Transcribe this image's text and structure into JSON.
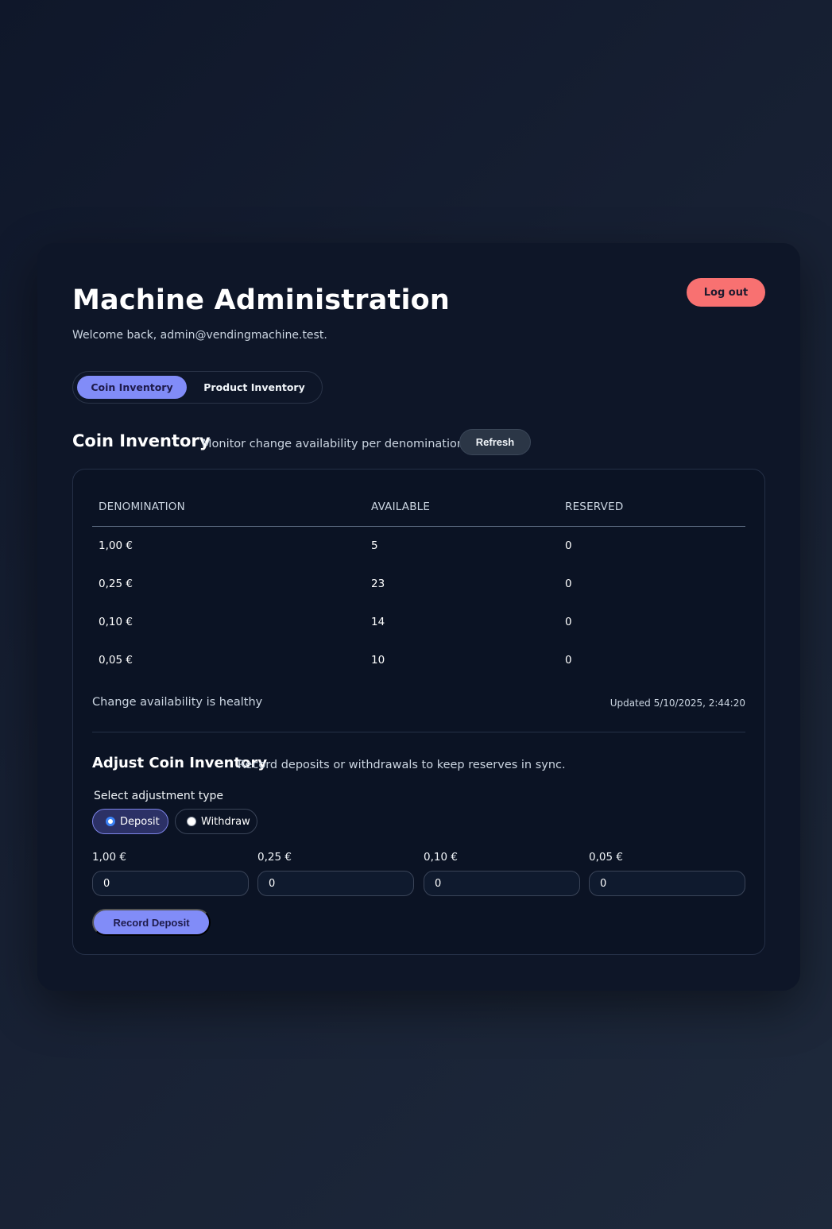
{
  "header": {
    "title": "Machine Administration",
    "welcome": "Welcome back, admin@vendingmachine.test.",
    "logout_label": "Log out"
  },
  "tabs": [
    {
      "label": "Coin Inventory",
      "active": true
    },
    {
      "label": "Product Inventory",
      "active": false
    }
  ],
  "section": {
    "title": "Coin Inventory",
    "subtitle": "Monitor change availability per denomination.",
    "refresh_label": "Refresh"
  },
  "table": {
    "headers": [
      "DENOMINATION",
      "AVAILABLE",
      "RESERVED"
    ],
    "rows": [
      {
        "denomination": "1,00 €",
        "available": "5",
        "reserved": "0"
      },
      {
        "denomination": "0,25 €",
        "available": "23",
        "reserved": "0"
      },
      {
        "denomination": "0,10 €",
        "available": "14",
        "reserved": "0"
      },
      {
        "denomination": "0,05 €",
        "available": "10",
        "reserved": "0"
      }
    ]
  },
  "status": {
    "text": "Change availability is healthy",
    "updated": "Updated 5/10/2025, 2:44:20"
  },
  "adjust": {
    "title": "Adjust Coin Inventory",
    "subtitle": "Record deposits or withdrawals to keep reserves in sync.",
    "type_label": "Select adjustment type",
    "options": [
      {
        "label": "Deposit",
        "selected": true
      },
      {
        "label": "Withdraw",
        "selected": false
      }
    ],
    "inputs": [
      {
        "label": "1,00 €",
        "value": "0"
      },
      {
        "label": "0,25 €",
        "value": "0"
      },
      {
        "label": "0,10 €",
        "value": "0"
      },
      {
        "label": "0,05 €",
        "value": "0"
      }
    ],
    "submit_label": "Record Deposit"
  },
  "colors": {
    "accent": "#818cf8",
    "danger": "#f87171",
    "background": "#0f172a",
    "card": "#0e1628"
  }
}
